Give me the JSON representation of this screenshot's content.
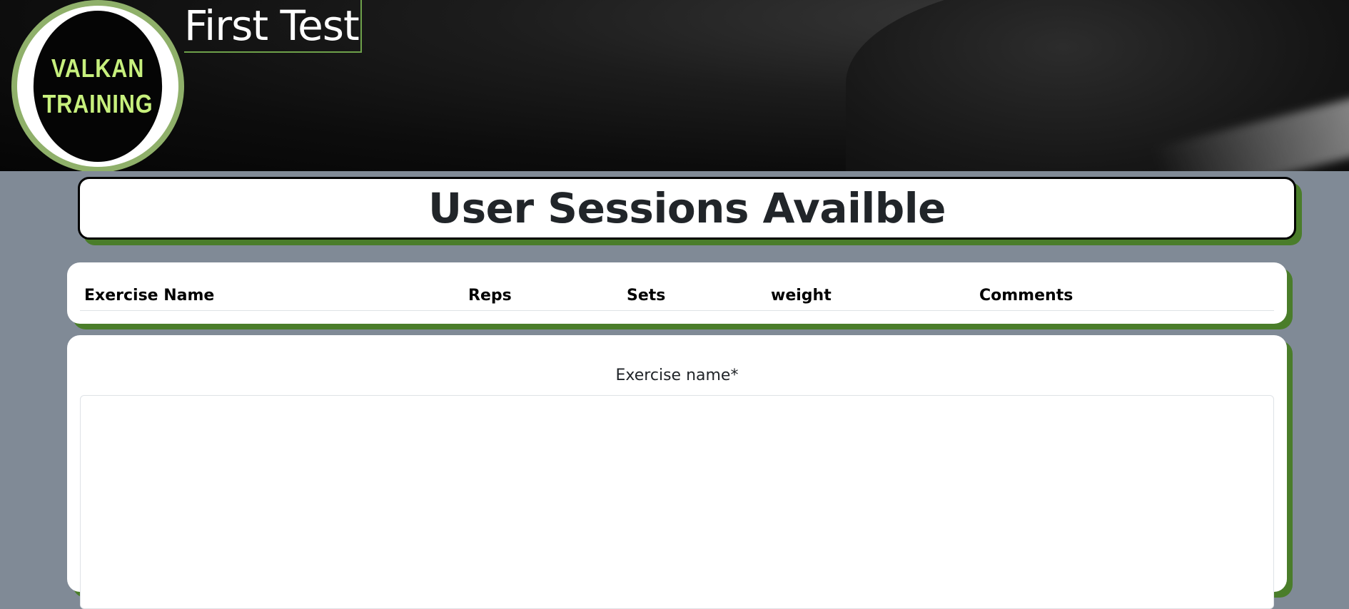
{
  "header": {
    "logo": {
      "line1": "VALKAN",
      "line2": "TRAINING"
    },
    "site_title": "First Test"
  },
  "main": {
    "title": "User Sessions Availble",
    "table": {
      "columns": [
        "Exercise Name",
        "Reps",
        "Sets",
        "weight",
        "Comments"
      ]
    },
    "form": {
      "exercise_name_label": "Exercise name*",
      "exercise_name_value": ""
    }
  },
  "colors": {
    "accent_green": "#4a7d2a",
    "logo_text": "#c7f07d",
    "page_background": "#808a96"
  }
}
